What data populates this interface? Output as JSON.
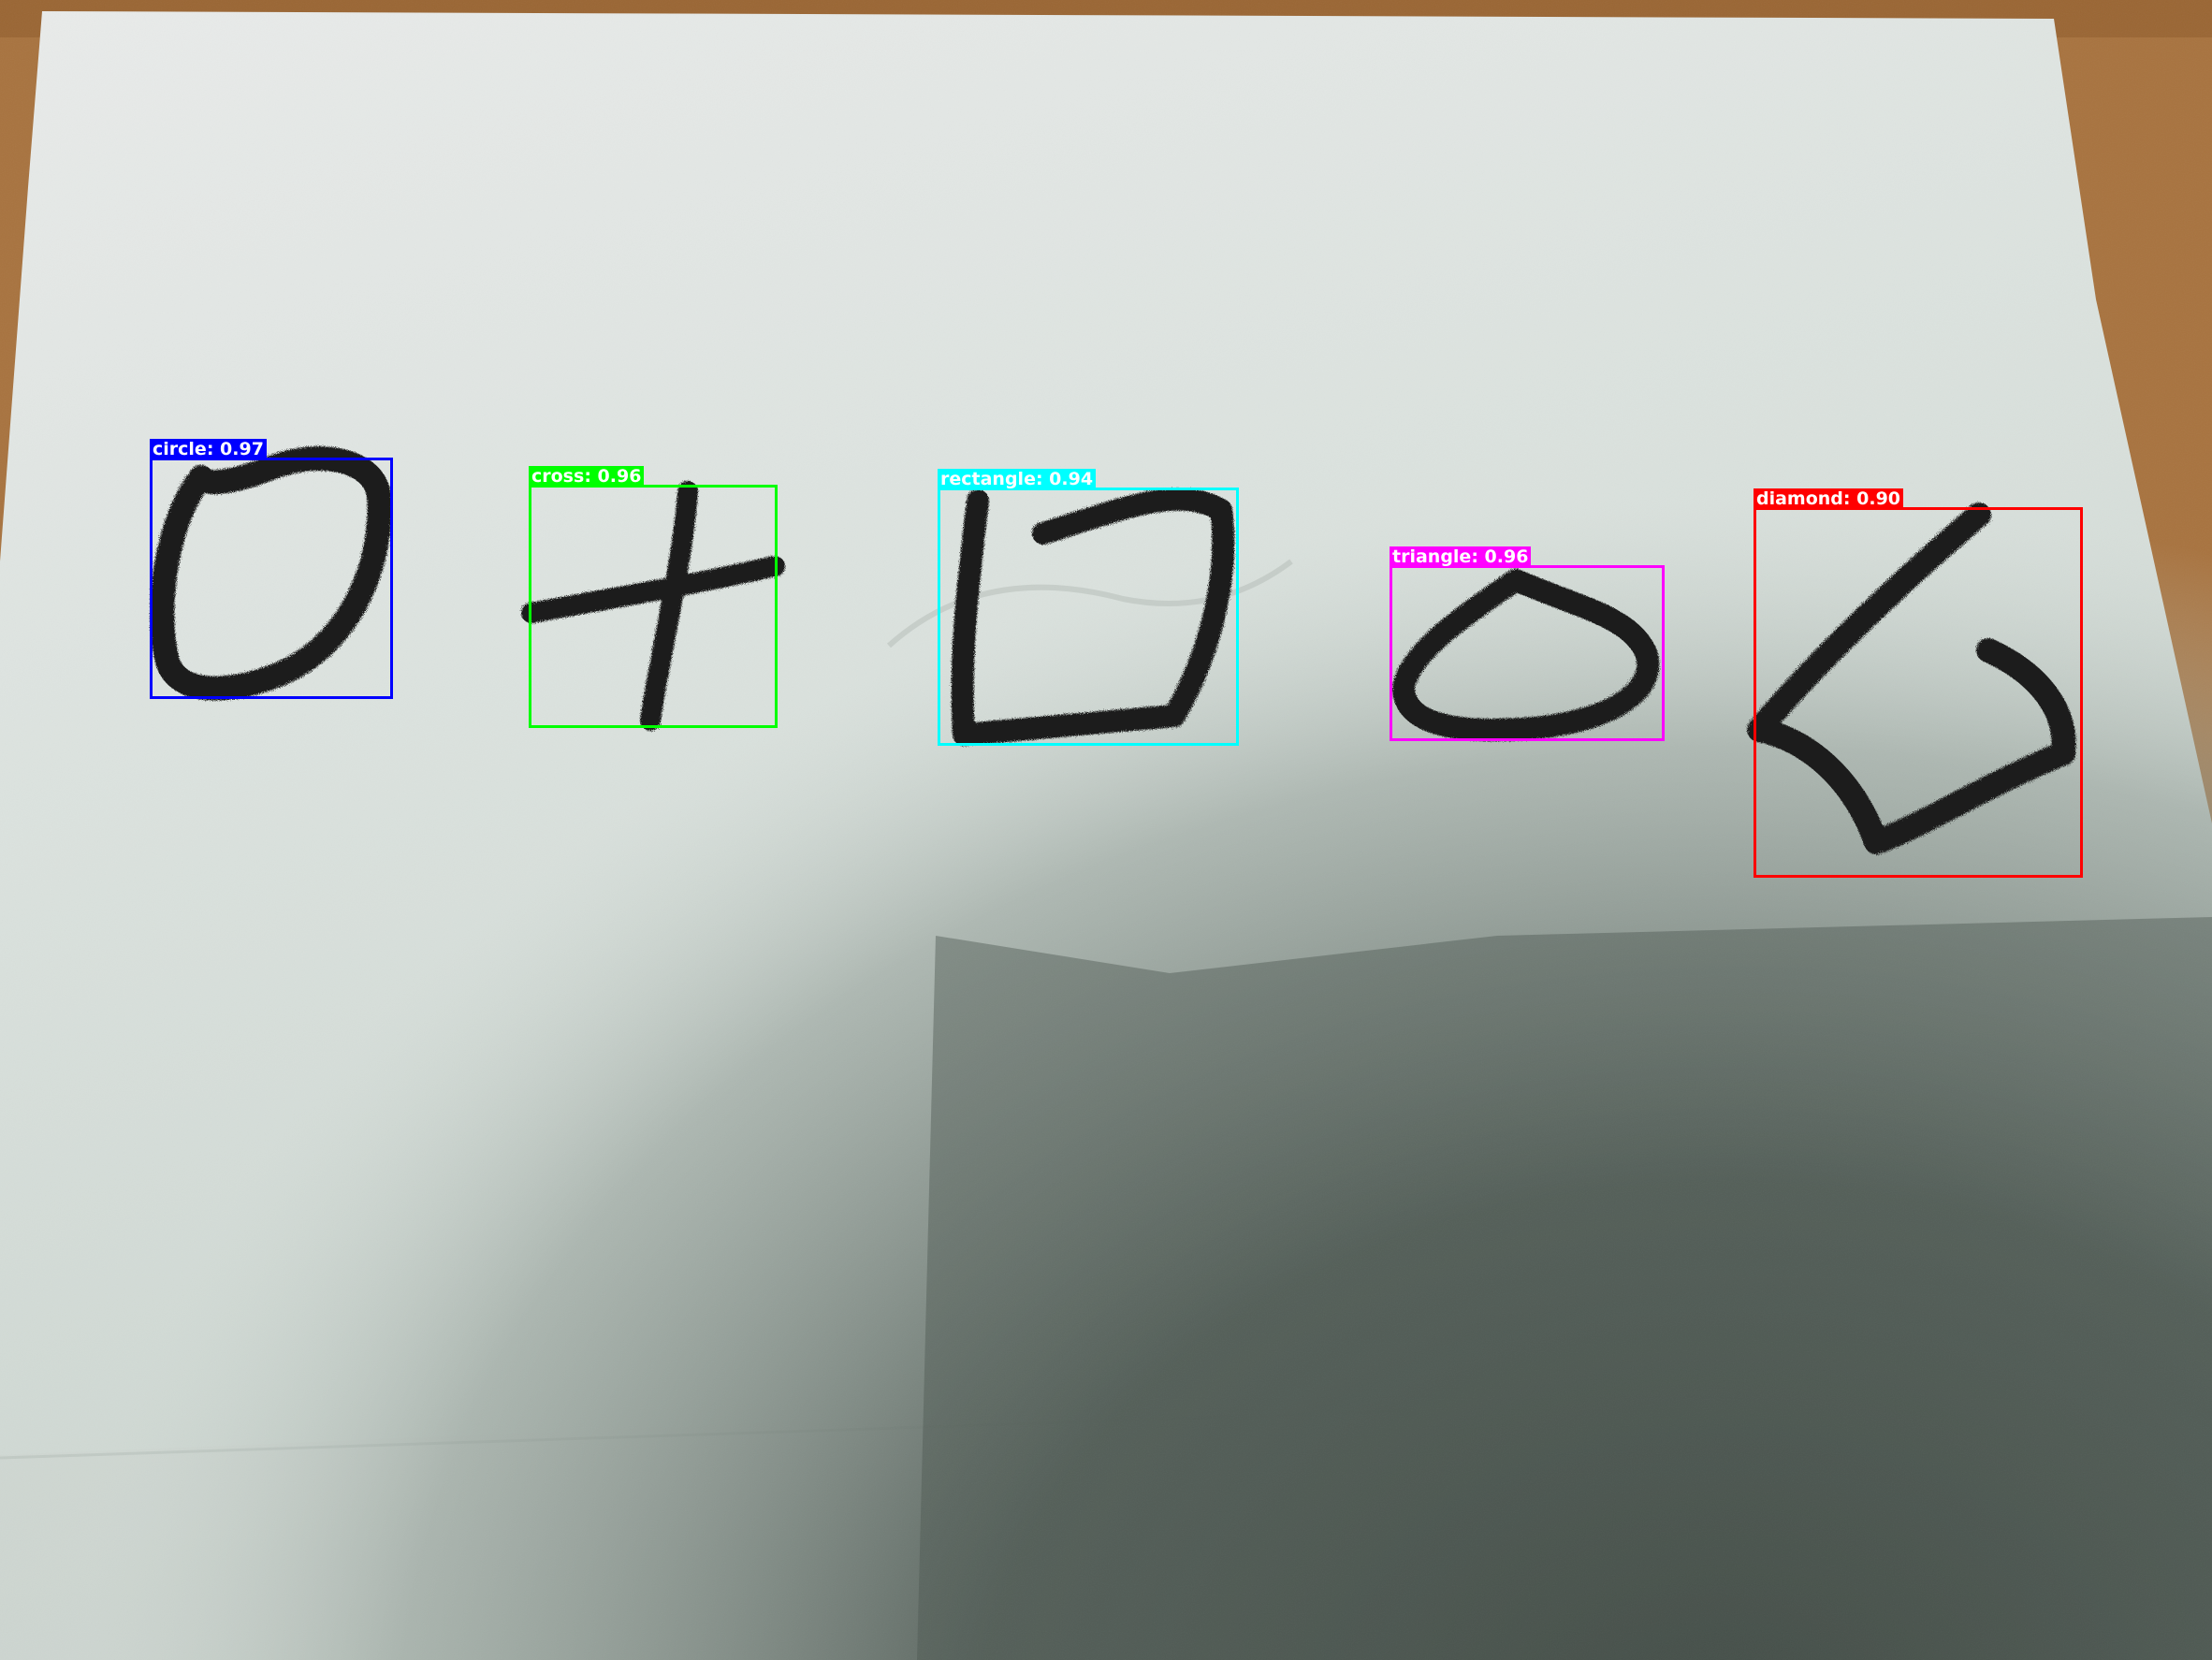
{
  "image": {
    "scene": "paper-with-hand-drawn-shapes",
    "background": "#b07a45"
  },
  "detections": [
    {
      "id": "circle",
      "label": "circle",
      "score": "0.97",
      "color": "#0000ff"
    },
    {
      "id": "cross",
      "label": "cross",
      "score": "0.96",
      "color": "#00ff00"
    },
    {
      "id": "rectangle",
      "label": "rectangle",
      "score": "0.94",
      "color": "#00ffff"
    },
    {
      "id": "triangle",
      "label": "triangle",
      "score": "0.96",
      "color": "#ff00ff"
    },
    {
      "id": "diamond",
      "label": "diamond",
      "score": "0.90",
      "color": "#ff0000"
    }
  ]
}
